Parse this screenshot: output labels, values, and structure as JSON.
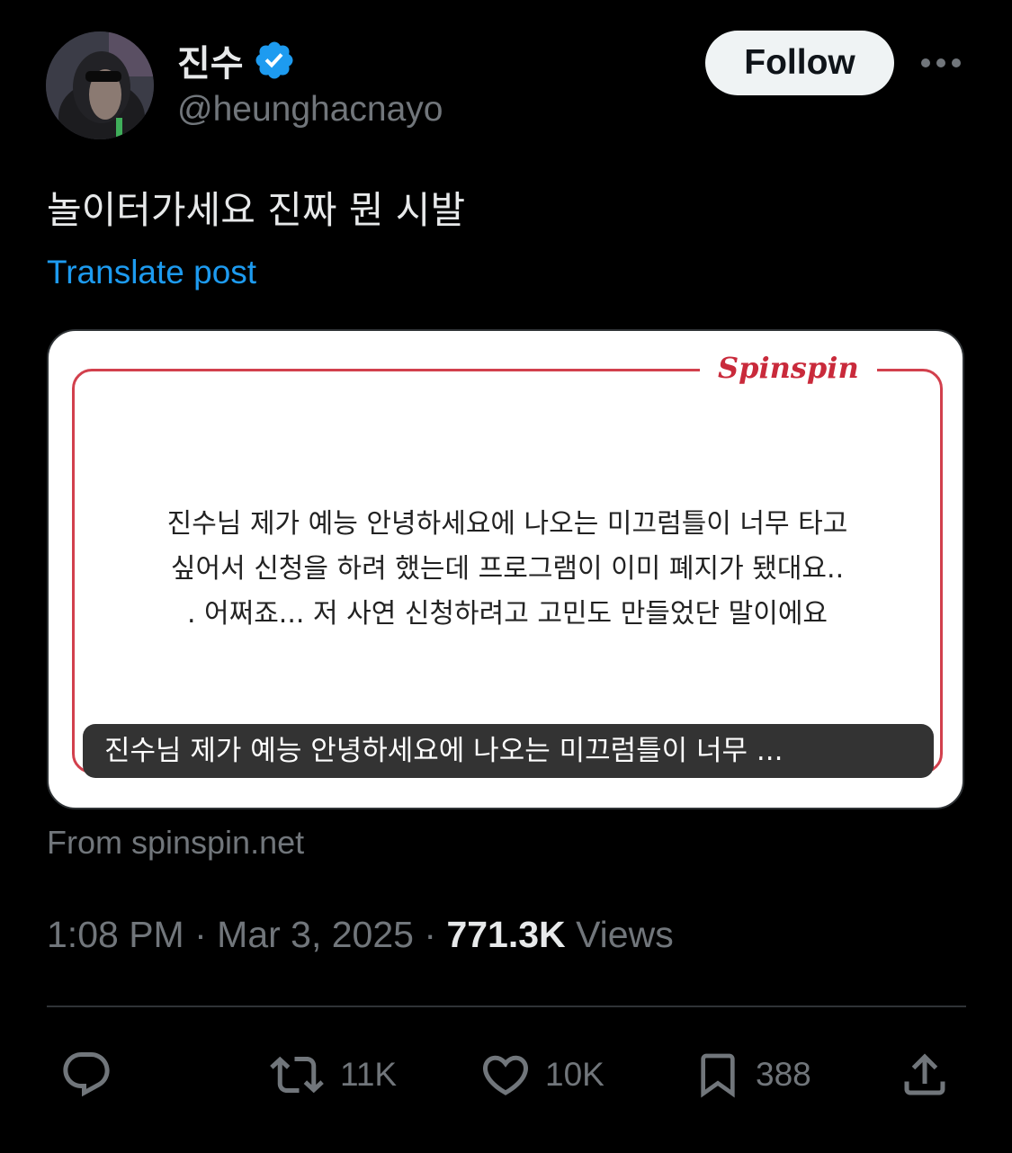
{
  "author": {
    "display_name": "진수",
    "handle": "@heunghacnayo",
    "verified": true
  },
  "follow_label": "Follow",
  "tweet": {
    "text": "놀이터가세요 진짜 뭔 시발",
    "translate_label": "Translate post"
  },
  "card": {
    "logo_text": "Spinspin",
    "body_lines": [
      "진수님 제가 예능 안녕하세요에 나오는 미끄럼틀이 너무 타고",
      "싶어서 신청을 하려 했는데 프로그램이 이미 폐지가 됐대요..",
      ". 어쩌죠... 저 사연 신청하려고 고민도 만들었단 말이에요"
    ],
    "caption": "진수님 제가 예능 안녕하세요에 나오는 미끄럼틀이 너무 ...",
    "source": "From spinspin.net"
  },
  "meta": {
    "time": "1:08 PM",
    "separator": "·",
    "date": "Mar 3, 2025",
    "views_count": "771.3K",
    "views_label": "Views"
  },
  "actions": {
    "reply": {
      "icon": "reply-icon",
      "count": ""
    },
    "retweet": {
      "icon": "retweet-icon",
      "count": "11K"
    },
    "like": {
      "icon": "heart-icon",
      "count": "10K"
    },
    "bookmark": {
      "icon": "bookmark-icon",
      "count": "388"
    },
    "share": {
      "icon": "share-icon"
    }
  },
  "colors": {
    "background": "#000000",
    "text": "#e7e9ea",
    "muted": "#71767b",
    "link": "#1d9bf0",
    "verified": "#1d9bf0",
    "card_accent": "#d2404d"
  }
}
